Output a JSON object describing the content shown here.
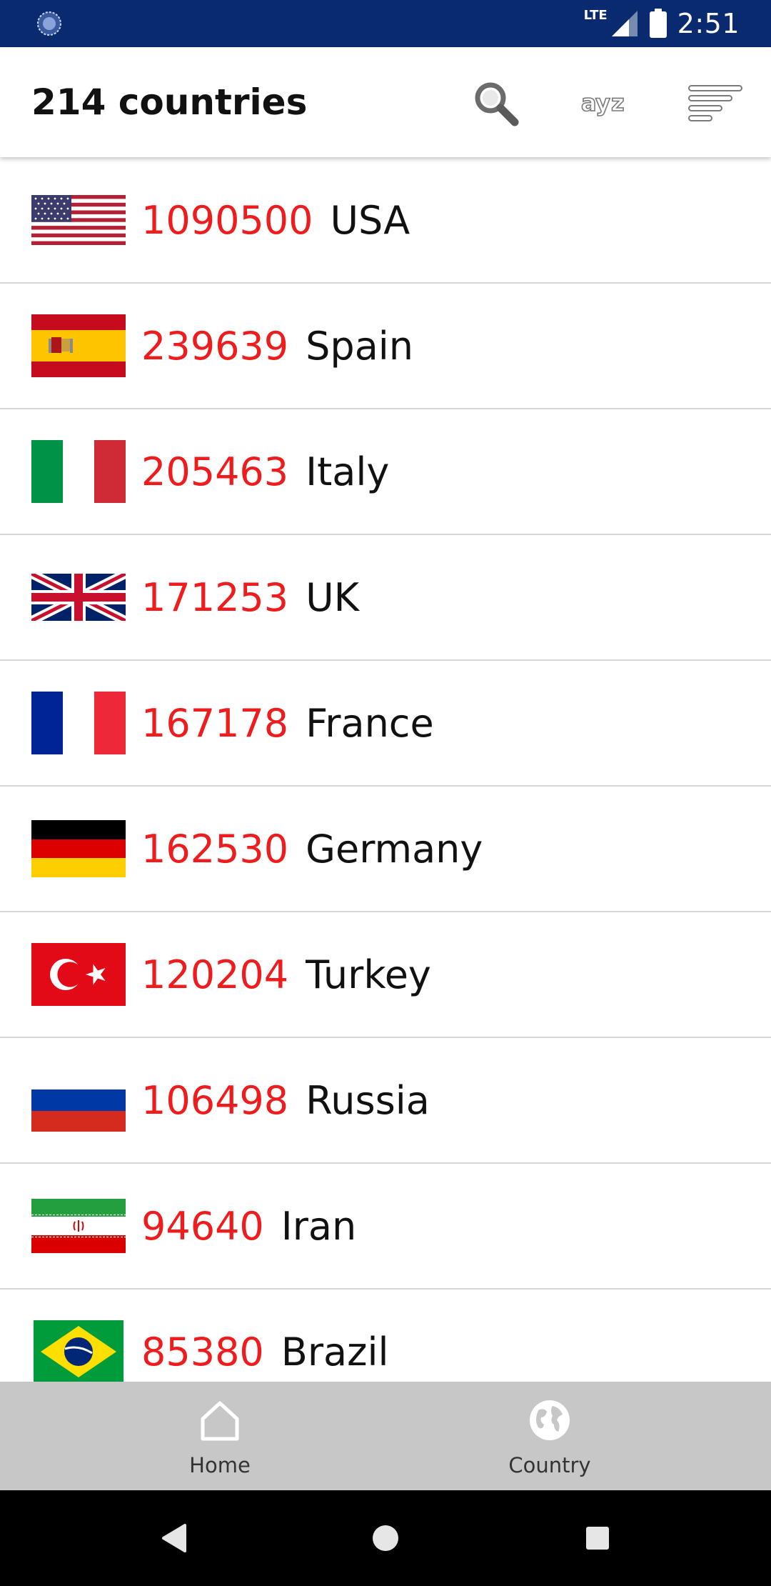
{
  "status_bar": {
    "network_label": "LTE",
    "time": "2:51",
    "background_color": "#0a2a70"
  },
  "app_bar": {
    "title": "214 countries",
    "actions": [
      {
        "name": "search",
        "icon": "search-icon"
      },
      {
        "name": "sort-alphabetical",
        "icon": "az-sort-icon"
      },
      {
        "name": "sort-by-count",
        "icon": "sort-lines-icon"
      }
    ]
  },
  "countries": [
    {
      "count": "1090500",
      "name": "USA",
      "flag_icon": "usa-flag-icon"
    },
    {
      "count": "239639",
      "name": "Spain",
      "flag_icon": "spain-flag-icon"
    },
    {
      "count": "205463",
      "name": "Italy",
      "flag_icon": "italy-flag-icon"
    },
    {
      "count": "171253",
      "name": "UK",
      "flag_icon": "uk-flag-icon"
    },
    {
      "count": "167178",
      "name": "France",
      "flag_icon": "france-flag-icon"
    },
    {
      "count": "162530",
      "name": "Germany",
      "flag_icon": "germany-flag-icon"
    },
    {
      "count": "120204",
      "name": "Turkey",
      "flag_icon": "turkey-flag-icon"
    },
    {
      "count": "106498",
      "name": "Russia",
      "flag_icon": "russia-flag-icon"
    },
    {
      "count": "94640",
      "name": "Iran",
      "flag_icon": "iran-flag-icon"
    },
    {
      "count": "85380",
      "name": "Brazil",
      "flag_icon": "brazil-flag-icon"
    }
  ],
  "bottom_nav": {
    "home_label": "Home",
    "country_label": "Country"
  },
  "colors": {
    "count_red": "#ee1c1c",
    "nav_background": "#c7c7c7",
    "divider": "#d6d6d6"
  }
}
